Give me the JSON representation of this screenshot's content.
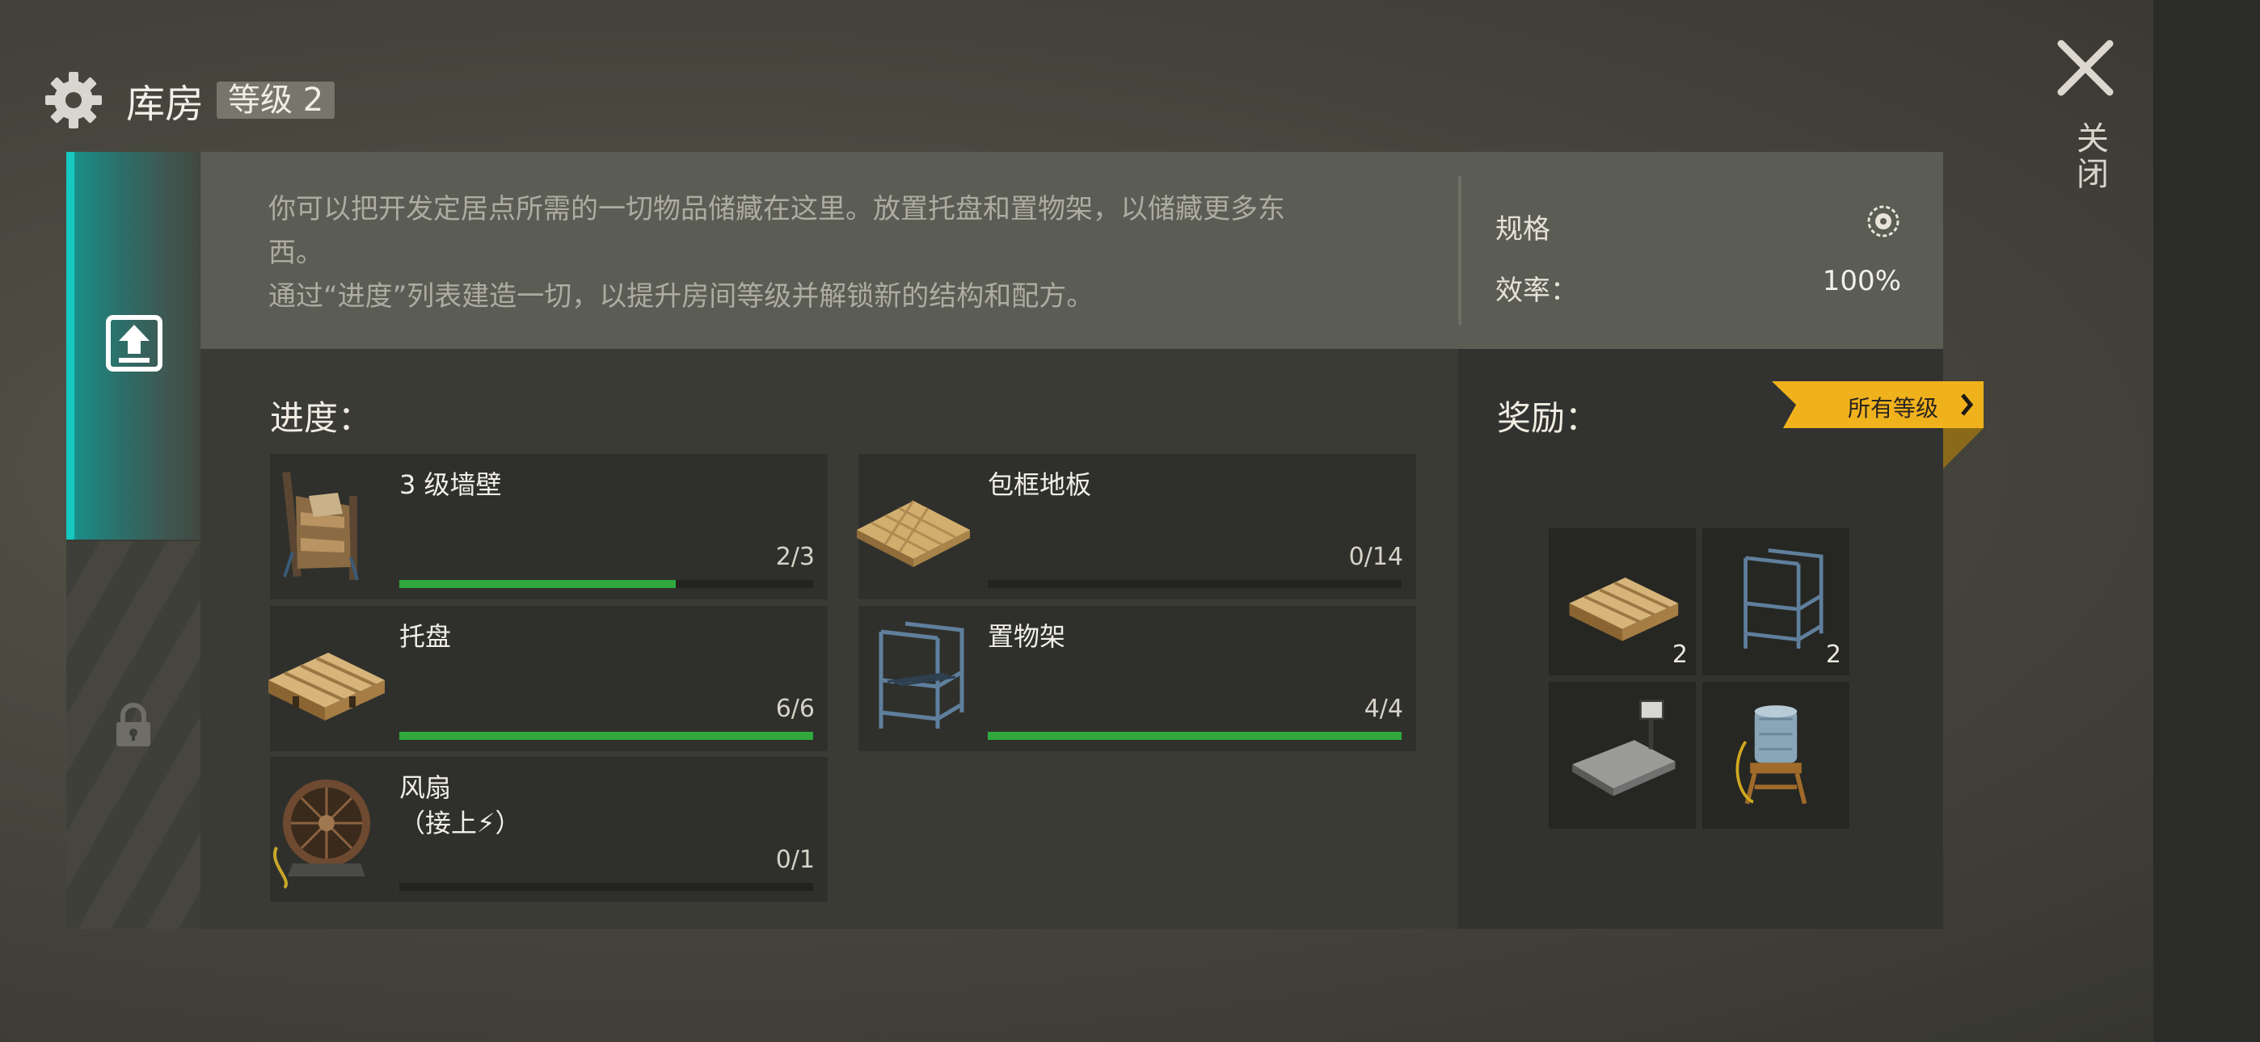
{
  "header": {
    "title": "库房",
    "level": "等级 2"
  },
  "close": {
    "label": "关闭"
  },
  "description": {
    "line1": "你可以把开发定居点所需的一切物品储藏在这里。放置托盘和置物架，以储藏更多东",
    "line2": "西。",
    "line3": "通过“进度”列表建造一切，以提升房间等级并解锁新的结构和配方。"
  },
  "spec": {
    "title": "规格",
    "efficiency_label": "效率：",
    "efficiency_value": "100%"
  },
  "progress": {
    "title": "进度：",
    "items": [
      {
        "name": "3 级墙壁",
        "count": "2/3",
        "progress": 0.667,
        "icon": "wall-icon"
      },
      {
        "name": "包框地板",
        "count": "0/14",
        "progress": 0.0,
        "icon": "floor-icon"
      },
      {
        "name": "托盘",
        "count": "6/6",
        "progress": 1.0,
        "icon": "pallet-icon"
      },
      {
        "name": "置物架",
        "count": "4/4",
        "progress": 1.0,
        "icon": "shelf-icon"
      },
      {
        "name": "风扇",
        "name2": "（接上⚡）",
        "count": "0/1",
        "progress": 0.0,
        "icon": "fan-icon"
      }
    ]
  },
  "rewards": {
    "title": "奖励：",
    "filter_label": "所有等级",
    "items": [
      {
        "icon": "pallet-icon",
        "count": "2"
      },
      {
        "icon": "shelf-icon",
        "count": "2"
      },
      {
        "icon": "scale-icon",
        "count": ""
      },
      {
        "icon": "water-tank-icon",
        "count": ""
      }
    ]
  },
  "colors": {
    "accent_teal": "#16c8bf",
    "progress_green": "#2fa83c",
    "badge_yellow": "#f0b21c"
  }
}
